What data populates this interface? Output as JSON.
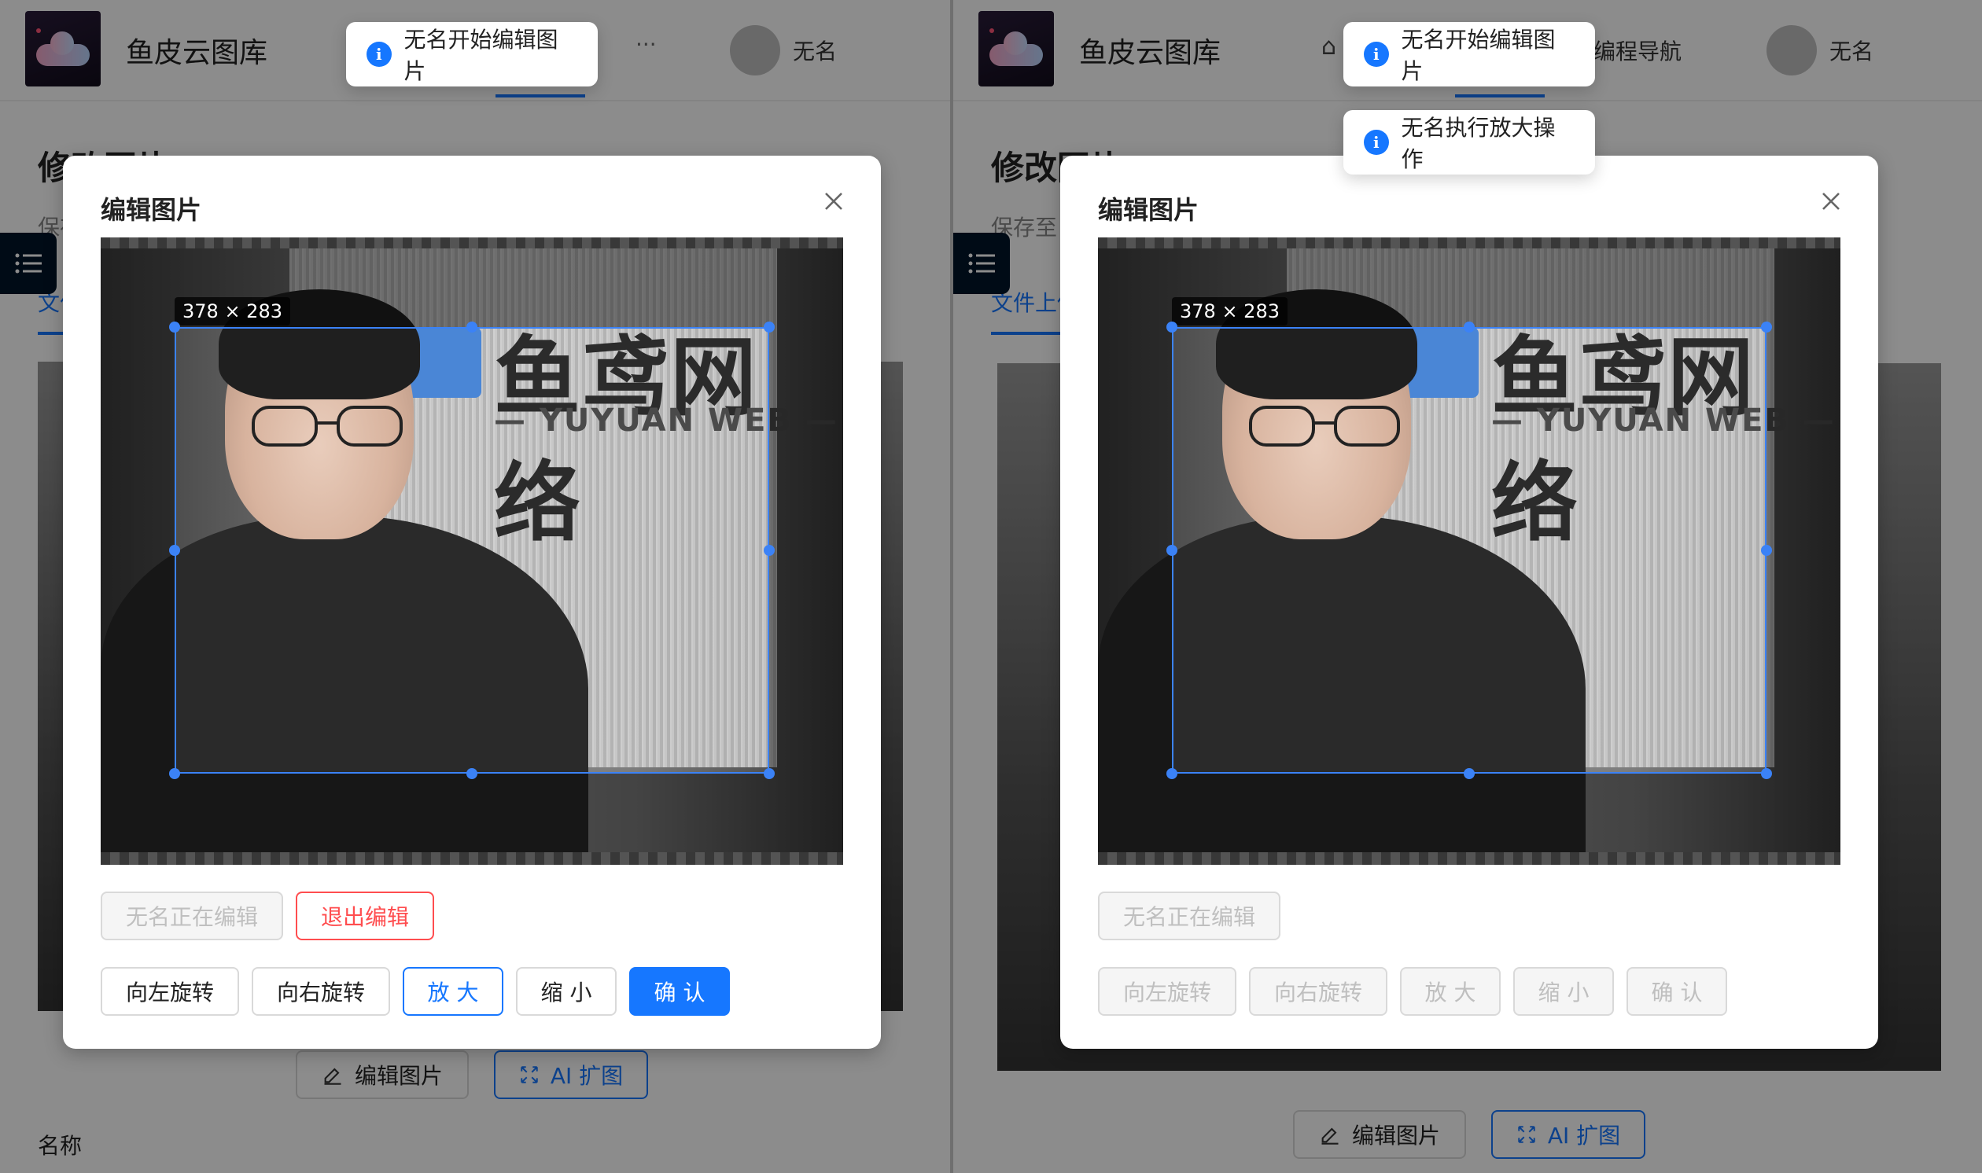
{
  "app": {
    "site_title": "鱼皮云图库",
    "username": "无名"
  },
  "left": {
    "nav_more": "···",
    "page": {
      "title": "修改图片",
      "subtitle": "保存至",
      "tab": "文件上传",
      "label_name": "名称"
    },
    "buttons": {
      "edit_image": "编辑图片",
      "ai_expand": "AI 扩图"
    },
    "toast": "无名开始编辑图片",
    "modal": {
      "title": "编辑图片",
      "crop_size": "378 × 283",
      "sign_text": "鱼鸢网络",
      "sign_sub": "— YUYUAN WEB —",
      "editing_status": "无名正在编辑",
      "exit_edit": "退出编辑",
      "rotate_left": "向左旋转",
      "rotate_right": "向右旋转",
      "zoom_in": "放 大",
      "zoom_out": "缩 小",
      "confirm": "确 认"
    }
  },
  "right": {
    "nav_link": "编程导航",
    "page": {
      "title": "修改图片",
      "subtitle": "保存至",
      "tab": "文件上传"
    },
    "buttons": {
      "edit_image": "编辑图片",
      "ai_expand": "AI 扩图"
    },
    "toasts": [
      "无名开始编辑图片",
      "无名执行放大操作"
    ],
    "modal": {
      "title": "编辑图片",
      "crop_size": "378 × 283",
      "sign_text": "鱼鸢网络",
      "sign_sub": "— YUYUAN WEB —",
      "editing_status": "无名正在编辑",
      "rotate_left": "向左旋转",
      "rotate_right": "向右旋转",
      "zoom_in": "放 大",
      "zoom_out": "缩 小",
      "confirm": "确 认"
    }
  },
  "colors": {
    "primary": "#1677ff",
    "danger": "#ff4d4f",
    "crop": "#3b82f6"
  }
}
